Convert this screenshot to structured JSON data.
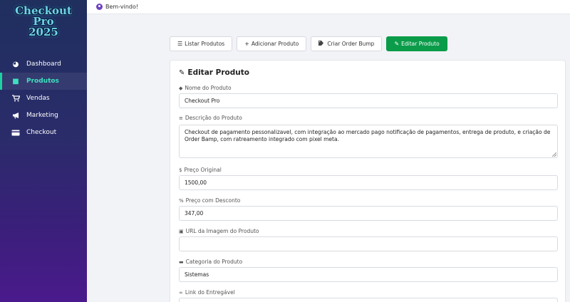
{
  "app": {
    "logo_lines": [
      "Checkout",
      "Pro",
      "2025"
    ]
  },
  "sidebar": {
    "items": [
      {
        "label": "Dashboard",
        "icon": "pie-chart-icon",
        "active": false
      },
      {
        "label": "Produtos",
        "icon": "box-icon",
        "active": true
      },
      {
        "label": "Vendas",
        "icon": "cart-icon",
        "active": false
      },
      {
        "label": "Marketing",
        "icon": "megaphone-icon",
        "active": false
      },
      {
        "label": "Checkout",
        "icon": "credit-card-icon",
        "active": false
      }
    ]
  },
  "topbar": {
    "greeting": "Bem-vindo!"
  },
  "tabs": [
    {
      "label": "Listar Produtos",
      "icon": "list-icon"
    },
    {
      "label": "Adicionar Produto",
      "icon": "plus-icon"
    },
    {
      "label": "Criar Order Bump",
      "icon": "tags-icon"
    },
    {
      "label": "Editar Produto",
      "icon": "edit-icon",
      "active": true
    }
  ],
  "form": {
    "title": "Editar Produto",
    "name_label": "Nome do Produto",
    "name_value": "Checkout Pro",
    "description_label": "Descrição do Produto",
    "description_value": "Checkout de pagamento pessonalizavel, com integração ao mercado pago notificação de pagamentos, entrega de produto, e criação de Order Bamp, com ratreamento integrado com pixel meta.",
    "price_label": "Preço Original",
    "price_value": "1500,00",
    "discount_label": "Preço com Desconto",
    "discount_value": "347,00",
    "image_label": "URL da Imagem do Produto",
    "image_value": "",
    "category_label": "Categoria do Produto",
    "category_value": "Sistemas",
    "link_label": "Link do Entregável"
  },
  "colors": {
    "accent_green": "#0b9c4a",
    "active_nav": "#3fe0c0",
    "sidebar_top": "#1f2f5e",
    "sidebar_bottom": "#4a1a8c"
  }
}
